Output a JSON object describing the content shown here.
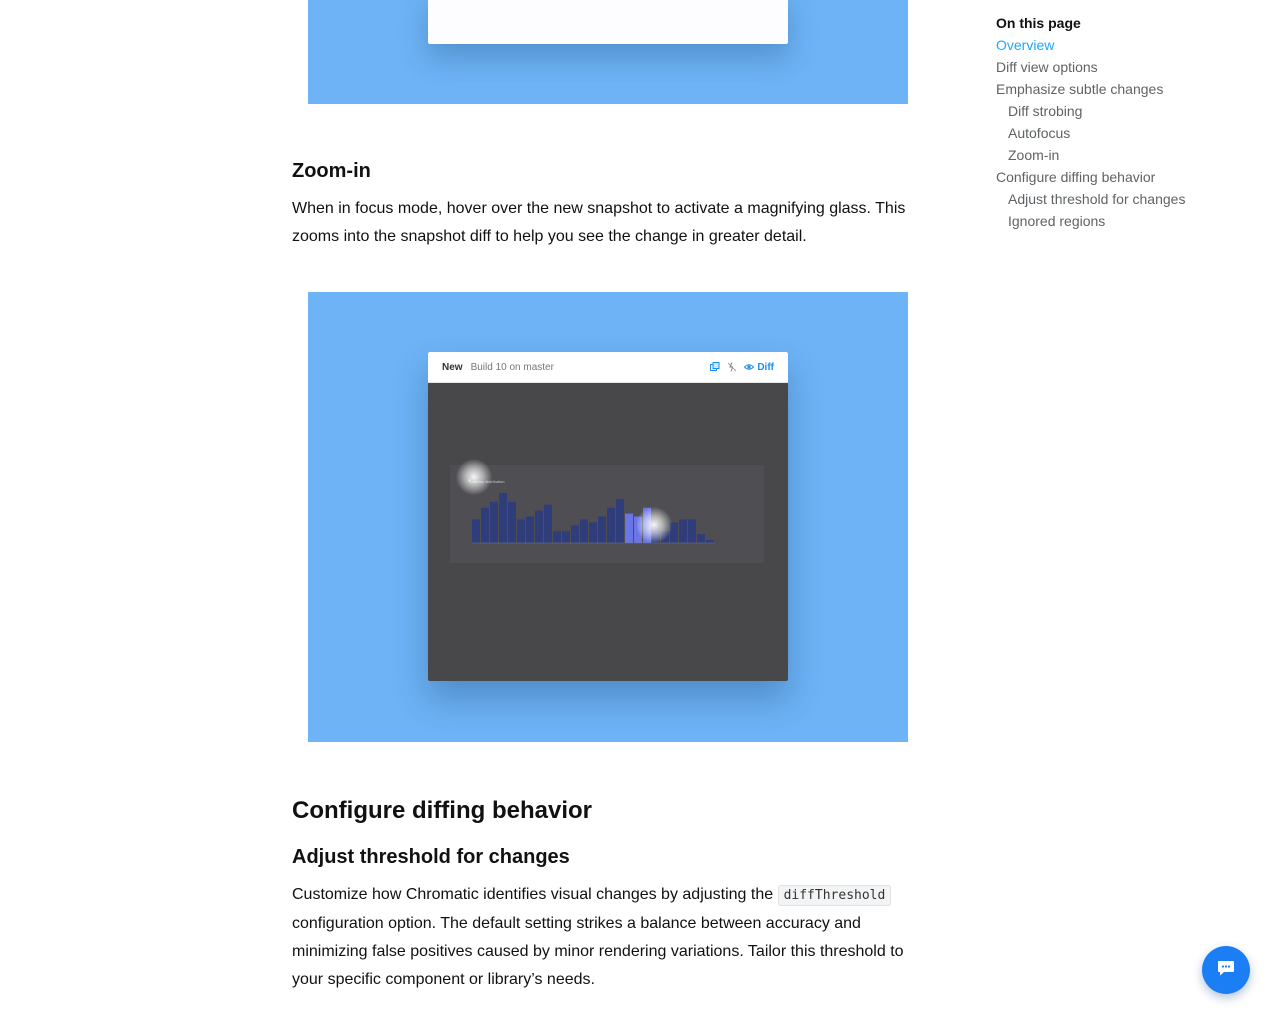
{
  "sections": {
    "zoom_in": {
      "heading": "Zoom-in",
      "body": "When in focus mode, hover over the new snapshot to activate a magnifying glass. This zooms into the snapshot diff to help you see the change in greater detail."
    },
    "configure": {
      "heading": "Configure diffing behavior"
    },
    "adjust_threshold": {
      "heading": "Adjust threshold for changes",
      "body_before": "Customize how Chromatic identifies visual changes by adjusting the ",
      "code": "diffThreshold",
      "body_after": " configuration option. The default setting strikes a balance between accuracy and minimizing false positives caused by minor rendering variations. Tailor this threshold to your specific component or library’s needs."
    }
  },
  "snapshot": {
    "label_new": "New",
    "build_info": "Build 10 on master",
    "diff_label": "Diff",
    "chart_title": "Latency distribution",
    "chart_bars": [
      8,
      12,
      14,
      17,
      14,
      8,
      9,
      11,
      13,
      4,
      4,
      6,
      8,
      7,
      9,
      12,
      15,
      10,
      9,
      12,
      6,
      4,
      7,
      8,
      8,
      3,
      1
    ],
    "highlight_color": "#6b76e6",
    "bar_color": "#2f3d7a"
  },
  "toc": {
    "title": "On this page",
    "items": [
      {
        "label": "Overview",
        "level": 0,
        "active": true
      },
      {
        "label": "Diff view options",
        "level": 0,
        "active": false
      },
      {
        "label": "Emphasize subtle changes",
        "level": 0,
        "active": false
      },
      {
        "label": "Diff strobing",
        "level": 1,
        "active": false
      },
      {
        "label": "Autofocus",
        "level": 1,
        "active": false
      },
      {
        "label": "Zoom-in",
        "level": 1,
        "active": false
      },
      {
        "label": "Configure diffing behavior",
        "level": 0,
        "active": false
      },
      {
        "label": "Adjust threshold for changes",
        "level": 1,
        "active": false
      },
      {
        "label": "Ignored regions",
        "level": 1,
        "active": false
      }
    ]
  },
  "colors": {
    "figure_background": "#6db3f5",
    "toc_active": "#1ea7fd",
    "chat_button": "#1c7ef5"
  },
  "icons": {
    "chat": "chat-bubble-icon",
    "diff": "eye-icon",
    "compare": "overlay-icon",
    "strobe": "strobe-icon"
  }
}
